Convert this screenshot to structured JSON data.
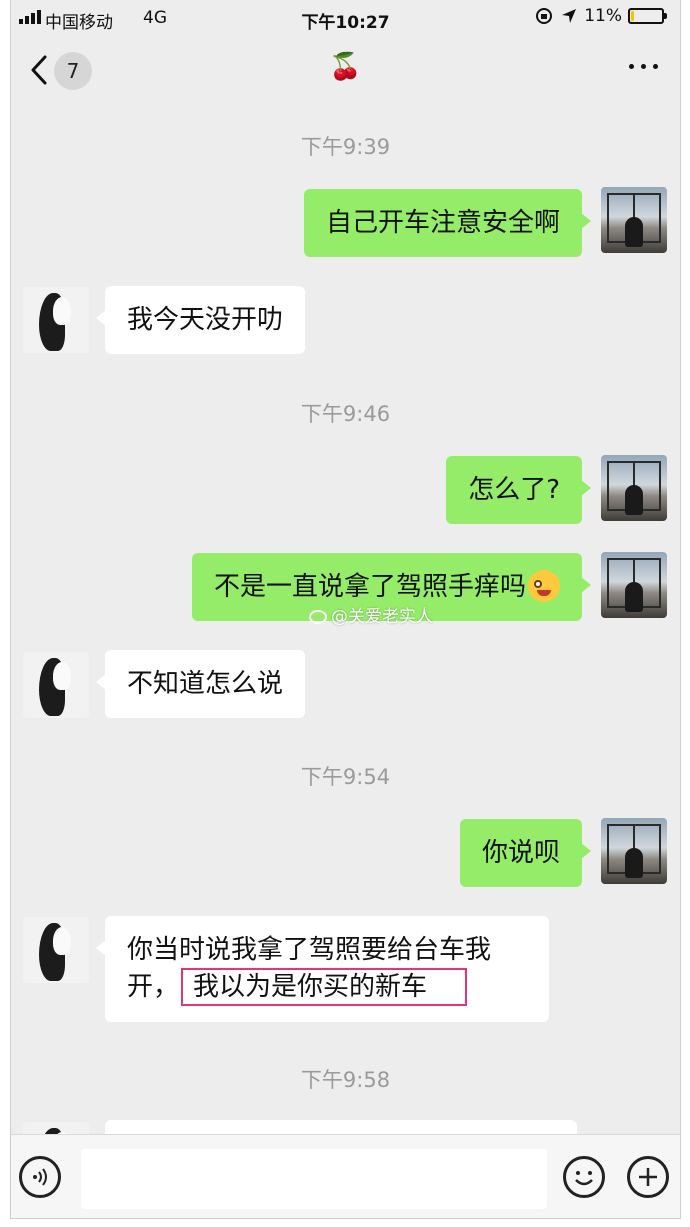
{
  "status_bar": {
    "carrier": "中国移动",
    "network": "4G",
    "time": "下午10:27",
    "battery_percent": "11%",
    "battery_level": 0.11
  },
  "nav": {
    "unread_count": "7",
    "title": "🍒"
  },
  "messages": [
    {
      "type": "timestamp",
      "text": "下午9:39"
    },
    {
      "type": "sent",
      "text": "自己开车注意安全啊"
    },
    {
      "type": "received",
      "text": "我今天没开叻"
    },
    {
      "type": "timestamp",
      "text": "下午9:46"
    },
    {
      "type": "sent",
      "text": "怎么了?"
    },
    {
      "type": "sent",
      "text": "不是一直说拿了驾照手痒吗",
      "emoji": "smiling-face-emoji"
    },
    {
      "type": "received",
      "text": "不知道怎么说"
    },
    {
      "type": "timestamp",
      "text": "下午9:54"
    },
    {
      "type": "sent",
      "text": "你说呗"
    },
    {
      "type": "received",
      "text": "你当时说我拿了驾照要给台车我开，",
      "highlighted_text": "我以为是你买的新车"
    },
    {
      "type": "timestamp",
      "text": "下午9:58"
    }
  ],
  "watermark": "@关爱老实人",
  "colors": {
    "background": "#ededed",
    "sent_bubble": "#95ec69",
    "received_bubble": "#ffffff",
    "highlight_border": "#e6337a"
  },
  "icons": {
    "back": "chevron-left-icon",
    "more": "more-dots-icon",
    "voice": "voice-icon",
    "emoji": "emoji-icon",
    "plus": "plus-icon"
  }
}
